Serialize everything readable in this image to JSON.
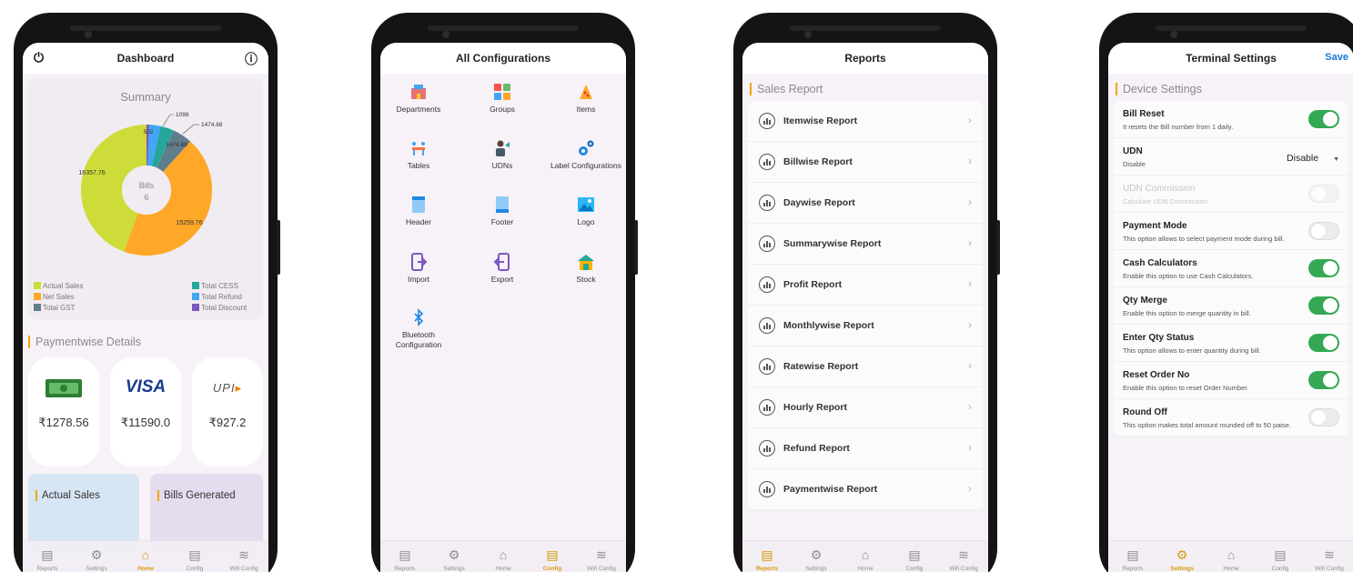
{
  "screen1": {
    "title": "Dashboard",
    "power_icon": "power-icon",
    "info_icon": "info-icon",
    "summary": {
      "title": "Summary",
      "center_label": "Bills",
      "center_value": "6",
      "labels": {
        "actual_sales": "16357.76",
        "net_sales": "15259.76",
        "gst": "1474.88",
        "gst_outer": "1474.88",
        "refund": "1098",
        "cess": "502"
      },
      "legend": [
        {
          "label": "Actual Sales",
          "color": "#cddc39"
        },
        {
          "label": "Net Sales",
          "color": "#ffa726"
        },
        {
          "label": "Total GST",
          "color": "#607d8b"
        },
        {
          "label": "Total CESS",
          "color": "#26a69a"
        },
        {
          "label": "Total Refund",
          "color": "#42a5f5"
        },
        {
          "label": "Total Discount",
          "color": "#7e57c2"
        }
      ]
    },
    "paymentwise": {
      "title": "Paymentwise Details",
      "cards": [
        {
          "icon": "cash-icon",
          "amount": "₹1278.56"
        },
        {
          "icon": "visa-icon",
          "brand": "VISA",
          "amount": "₹11590.0"
        },
        {
          "icon": "upi-icon",
          "brand": "UPI",
          "amount": "₹927.2"
        }
      ]
    },
    "bottom_cards": [
      {
        "label": "Actual Sales"
      },
      {
        "label": "Bills Generated"
      }
    ]
  },
  "screen2": {
    "title": "All Configurations",
    "items": [
      {
        "label": "Departments",
        "icon": "departments-icon"
      },
      {
        "label": "Groups",
        "icon": "groups-icon"
      },
      {
        "label": "Items",
        "icon": "items-icon"
      },
      {
        "label": "Tables",
        "icon": "tables-icon"
      },
      {
        "label": "UDNs",
        "icon": "udns-icon"
      },
      {
        "label": "Label Configurations",
        "icon": "label-config-icon"
      },
      {
        "label": "Header",
        "icon": "header-icon"
      },
      {
        "label": "Footer",
        "icon": "footer-icon"
      },
      {
        "label": "Logo",
        "icon": "logo-icon"
      },
      {
        "label": "Import",
        "icon": "import-icon"
      },
      {
        "label": "Export",
        "icon": "export-icon"
      },
      {
        "label": "Stock",
        "icon": "stock-icon"
      },
      {
        "label": "Bluetooth Configuration",
        "icon": "bluetooth-icon"
      }
    ]
  },
  "screen3": {
    "title": "Reports",
    "section": "Sales Report",
    "reports": [
      "Itemwise Report",
      "Billwise Report",
      "Daywise Report",
      "Summarywise Report",
      "Profit Report",
      "Monthlywise Report",
      "Ratewise Report",
      "Hourly Report",
      "Refund Report",
      "Paymentwise Report"
    ]
  },
  "screen4": {
    "title": "Terminal Settings",
    "save": "Save",
    "section": "Device Settings",
    "settings": [
      {
        "title": "Bill Reset",
        "desc": "It resets the Bill number from 1 daily.",
        "control": "toggle",
        "on": true
      },
      {
        "title": "UDN",
        "desc": "Disable",
        "control": "dropdown",
        "value": "Disable"
      },
      {
        "title": "UDN Commission",
        "desc": "Calculate UDN Commission",
        "control": "toggle",
        "on": false,
        "disabled": true
      },
      {
        "title": "Payment Mode",
        "desc": "This option allows to select payment mode during bill.",
        "control": "toggle",
        "on": false
      },
      {
        "title": "Cash Calculators",
        "desc": "Enable this option to use Cash Calculators.",
        "control": "toggle",
        "on": true
      },
      {
        "title": "Qty Merge",
        "desc": "Enable this option to merge quantity in bill.",
        "control": "toggle",
        "on": true
      },
      {
        "title": "Enter Qty Status",
        "desc": "This option allows to enter quantity during bill.",
        "control": "toggle",
        "on": true
      },
      {
        "title": "Reset Order No",
        "desc": "Enable this option to reset Order Number.",
        "control": "toggle",
        "on": true
      },
      {
        "title": "Round Off",
        "desc": "This option makes total amount rounded off to 50 paise.",
        "control": "toggle",
        "on": false
      }
    ]
  },
  "nav": {
    "items": [
      {
        "label": "Reports",
        "icon": "reports-icon"
      },
      {
        "label": "Settings",
        "icon": "settings-icon"
      },
      {
        "label": "Home",
        "icon": "home-icon"
      },
      {
        "label": "Config",
        "icon": "config-icon"
      },
      {
        "label": "Wifi Config",
        "icon": "wifi-icon"
      }
    ],
    "active_per_screen": [
      "Home",
      "Config",
      "Reports",
      "Settings"
    ]
  },
  "colors": {
    "accent": "#f0a500",
    "toggle_on": "#34a853",
    "link": "#1976d2"
  }
}
